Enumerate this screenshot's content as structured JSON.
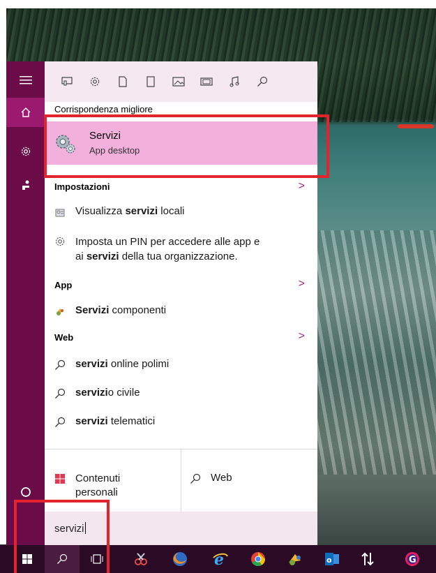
{
  "best_match": {
    "heading": "Corrispondenza migliore",
    "name": "Servizi",
    "subtitle": "App desktop"
  },
  "sections": {
    "settings": "Impostazioni",
    "app": "App",
    "web": "Web"
  },
  "settings_items": [
    {
      "pre": "Visualizza ",
      "bold": "servizi",
      "post": " locali"
    },
    {
      "line1": "Imposta un PIN per accedere alle app e",
      "pre2": "ai ",
      "bold": "servizi",
      "post2": " della tua organizzazione."
    }
  ],
  "app_items": [
    {
      "bold": "Servizi",
      "post": " componenti"
    }
  ],
  "web_items": [
    {
      "bold": "servizi",
      "post": " online polimi"
    },
    {
      "bold": "servizi",
      "post": "o civile"
    },
    {
      "bold": "servizi",
      "post": " telematici"
    }
  ],
  "bottom": {
    "contenuti_line1": "Contenuti",
    "contenuti_line2": "personali",
    "web": "Web"
  },
  "search": {
    "value": "servizi"
  },
  "chevron": ">"
}
